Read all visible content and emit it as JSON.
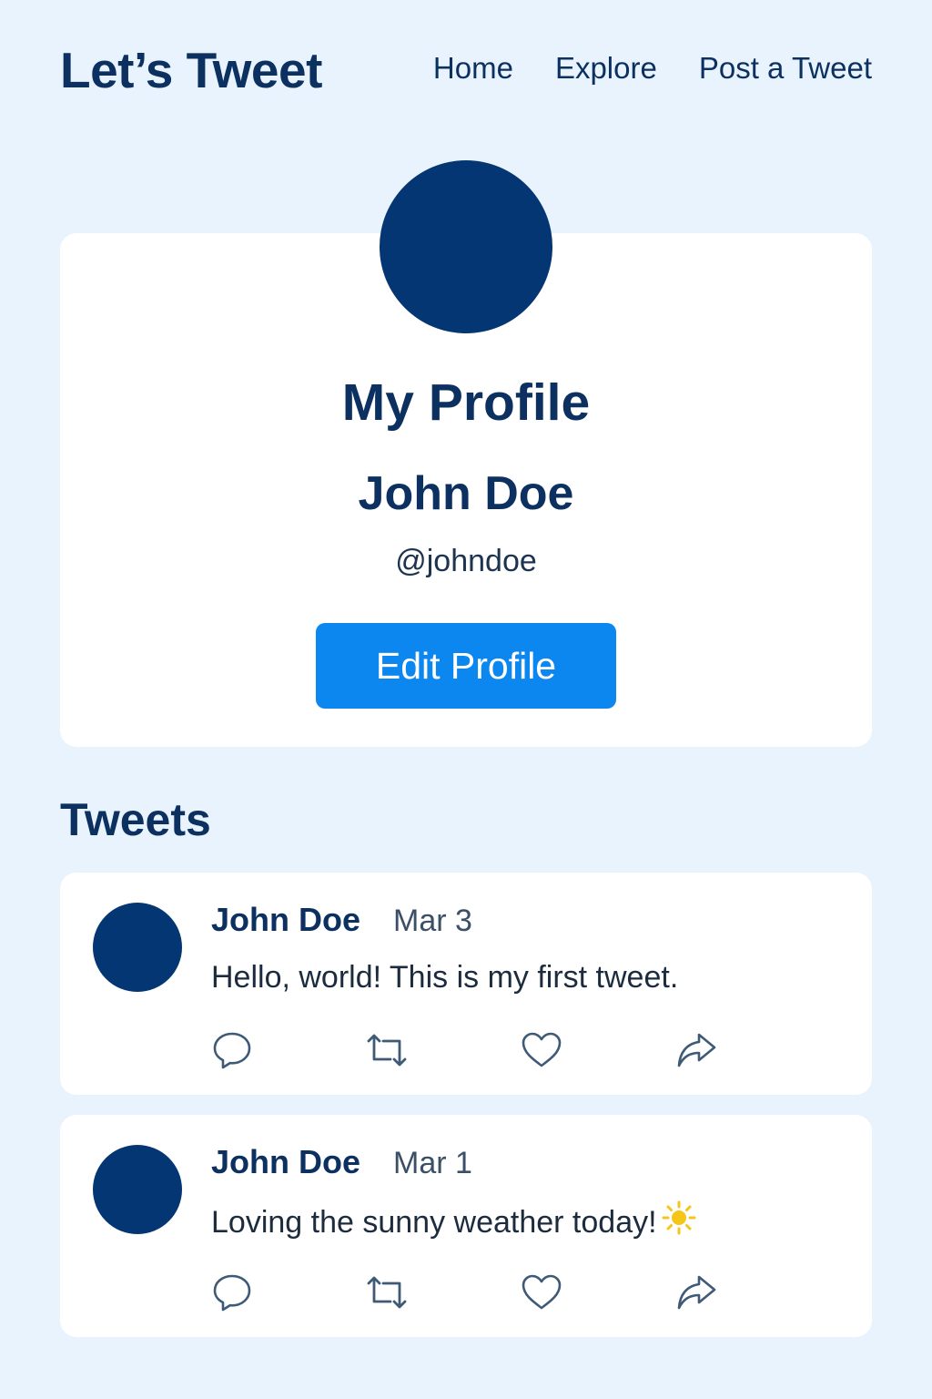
{
  "header": {
    "brand": "Let’s Tweet",
    "nav": {
      "home": "Home",
      "explore": "Explore",
      "post": "Post a Tweet"
    }
  },
  "profile": {
    "heading": "My Profile",
    "name": "John Doe",
    "handle": "@johndoe",
    "edit_label": "Edit Profile",
    "avatar_color": "#033672"
  },
  "tweets_section": {
    "heading": "Tweets",
    "tweets": [
      {
        "author": "John Doe",
        "date": "Mar 3",
        "text": "Hello, world! This is my first tweet."
      },
      {
        "author": "John Doe",
        "date": "Mar 1",
        "text": "Loving the sunny weather today!",
        "emoji": "sun-icon"
      }
    ],
    "actions": [
      "reply-icon",
      "retweet-icon",
      "like-icon",
      "share-icon"
    ]
  },
  "colors": {
    "background": "#e8f3fd",
    "primary_text": "#0c3160",
    "button": "#0d87f0",
    "card": "#ffffff"
  }
}
